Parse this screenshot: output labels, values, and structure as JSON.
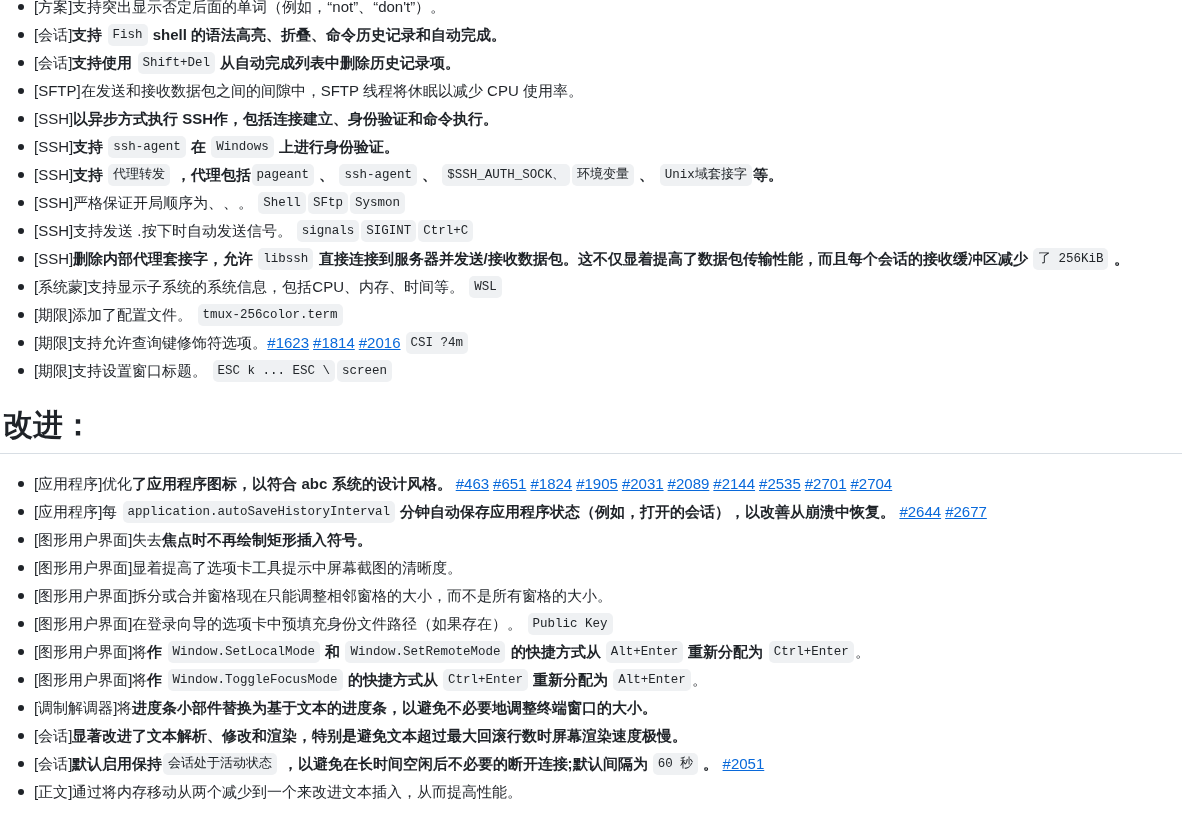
{
  "features": [
    {
      "parts": [
        {
          "kind": "text",
          "text": "[方案]支持突出显示否定后面的单词（例如，“not”、“don't”）。"
        }
      ]
    },
    {
      "parts": [
        {
          "kind": "text",
          "text": "[会话]**支持** "
        },
        {
          "kind": "code",
          "text": "Fish"
        },
        {
          "kind": "text",
          "text": " **shell 的语法高亮、折叠、命令历史记录和自动完成。**"
        }
      ]
    },
    {
      "parts": [
        {
          "kind": "text",
          "text": "[会话]**支持使用** "
        },
        {
          "kind": "code",
          "text": "Shift+Del"
        },
        {
          "kind": "text",
          "text": " **从自动完成列表中删除历史记录项。**"
        }
      ]
    },
    {
      "parts": [
        {
          "kind": "text",
          "text": "[SFTP]在发送和接收数据包之间的间隙中，SFTP 线程将休眠以减少 CPU 使用率。"
        }
      ]
    },
    {
      "parts": [
        {
          "kind": "text",
          "text": "[SSH]**以异步方式执行 SSH作，包括连接建立、身份验证和命令执行。**"
        }
      ]
    },
    {
      "parts": [
        {
          "kind": "text",
          "text": "[SSH]**支持** "
        },
        {
          "kind": "code",
          "text": "ssh-agent"
        },
        {
          "kind": "text",
          "text": " **在** "
        },
        {
          "kind": "code",
          "text": "Windows"
        },
        {
          "kind": "text",
          "text": " **上进行身份验证。**"
        }
      ]
    },
    {
      "parts": [
        {
          "kind": "text",
          "text": "[SSH]**支持** "
        },
        {
          "kind": "code",
          "text": "代理转发"
        },
        {
          "kind": "text",
          "text": " **，代理包括**"
        },
        {
          "kind": "code",
          "text": "pageant"
        },
        {
          "kind": "text",
          "text": " **、** "
        },
        {
          "kind": "code",
          "text": "ssh-agent"
        },
        {
          "kind": "text",
          "text": " **、** "
        },
        {
          "kind": "code",
          "text": "$SSH_AUTH_SOCK、"
        },
        {
          "kind": "code",
          "text": "环境变量"
        },
        {
          "kind": "text",
          "text": " **、** "
        },
        {
          "kind": "code",
          "text": "Unix域套接字"
        },
        {
          "kind": "text",
          "text": "**等。**"
        }
      ]
    },
    {
      "parts": [
        {
          "kind": "text",
          "text": "[SSH]严格保证开局顺序为、、。 "
        },
        {
          "kind": "code",
          "text": "Shell"
        },
        {
          "kind": "code",
          "text": "SFtp"
        },
        {
          "kind": "code",
          "text": "Sysmon"
        }
      ]
    },
    {
      "parts": [
        {
          "kind": "text",
          "text": "[SSH]支持发送 .按下时自动发送信号。 "
        },
        {
          "kind": "code",
          "text": "signals"
        },
        {
          "kind": "code",
          "text": "SIGINT"
        },
        {
          "kind": "code",
          "text": "Ctrl+C"
        }
      ]
    },
    {
      "parts": [
        {
          "kind": "text",
          "text": "[SSH]**删除内部代理套接字，允许** "
        },
        {
          "kind": "code",
          "text": "libssh"
        },
        {
          "kind": "text",
          "text": " **直接连接到服务器并发送/接收数据包。这不仅显着提高了数据包传输性能，而且每个会话的接收缓冲区减少** "
        },
        {
          "kind": "code",
          "text": "了 256KiB"
        },
        {
          "kind": "text",
          "text": " **。**"
        }
      ]
    },
    {
      "parts": [
        {
          "kind": "text",
          "text": "[系统蒙]支持显示子系统的系统信息，包括CPU、内存、时间等。 "
        },
        {
          "kind": "code",
          "text": "WSL"
        }
      ]
    },
    {
      "parts": [
        {
          "kind": "text",
          "text": "[期限]添加了配置文件。 "
        },
        {
          "kind": "code",
          "text": "tmux-256color.term"
        }
      ]
    },
    {
      "parts": [
        {
          "kind": "text",
          "text": "[期限]支持允许查询键修饰符选项。"
        },
        {
          "kind": "link",
          "text": "#1623"
        },
        {
          "kind": "link",
          "text": "#1814"
        },
        {
          "kind": "link",
          "text": "#2016"
        },
        {
          "kind": "code",
          "text": "CSI ?4m"
        }
      ]
    },
    {
      "parts": [
        {
          "kind": "text",
          "text": "[期限]支持设置窗口标题。 "
        },
        {
          "kind": "code",
          "text": "ESC k ... ESC \\"
        },
        {
          "kind": "code",
          "text": "screen"
        }
      ]
    }
  ],
  "improvements_heading": "改进：",
  "improvements": [
    {
      "parts": [
        {
          "kind": "text",
          "text": "[应用程序]优化**了应用程序图标，以符合 abc 系统的设计风格。** "
        },
        {
          "kind": "link",
          "text": "#463"
        },
        {
          "kind": "link",
          "text": "#651"
        },
        {
          "kind": "link",
          "text": "#1824"
        },
        {
          "kind": "link",
          "text": "#1905"
        },
        {
          "kind": "link",
          "text": "#2031"
        },
        {
          "kind": "link",
          "text": "#2089"
        },
        {
          "kind": "link",
          "text": "#2144"
        },
        {
          "kind": "link",
          "text": "#2535"
        },
        {
          "kind": "link",
          "text": "#2701"
        },
        {
          "kind": "link",
          "text": "#2704"
        }
      ]
    },
    {
      "parts": [
        {
          "kind": "text",
          "text": "[应用程序]每 "
        },
        {
          "kind": "code",
          "text": "application.autoSaveHistoryInterval"
        },
        {
          "kind": "text",
          "text": " **分钟自动保存应用程序状态（例如，打开的会话），以改善从崩溃中恢复。** "
        },
        {
          "kind": "link",
          "text": "#2644"
        },
        {
          "kind": "link",
          "text": "#2677"
        }
      ]
    },
    {
      "parts": [
        {
          "kind": "text",
          "text": "[图形用户界面]失去**焦点时不再绘制矩形插入符号。**"
        }
      ]
    },
    {
      "parts": [
        {
          "kind": "text",
          "text": "[图形用户界面]显着提高了选项卡工具提示中屏幕截图的清晰度。"
        }
      ]
    },
    {
      "parts": [
        {
          "kind": "text",
          "text": "[图形用户界面]拆分或合并窗格现在只能调整相邻窗格的大小，而不是所有窗格的大小。"
        }
      ]
    },
    {
      "parts": [
        {
          "kind": "text",
          "text": "[图形用户界面]在登录向导的选项卡中预填充身份文件路径（如果存在）。 "
        },
        {
          "kind": "code",
          "text": "Public Key"
        }
      ]
    },
    {
      "parts": [
        {
          "kind": "text",
          "text": "[图形用户界面]将**作** "
        },
        {
          "kind": "code",
          "text": "Window.SetLocalMode"
        },
        {
          "kind": "text",
          "text": " **和** "
        },
        {
          "kind": "code",
          "text": "Window.SetRemoteMode"
        },
        {
          "kind": "text",
          "text": " **的快捷方式从** "
        },
        {
          "kind": "code",
          "text": "Alt+Enter"
        },
        {
          "kind": "text",
          "text": " **重新分配为** "
        },
        {
          "kind": "code",
          "text": "Ctrl+Enter"
        },
        {
          "kind": "text",
          "text": "。"
        }
      ]
    },
    {
      "parts": [
        {
          "kind": "text",
          "text": "[图形用户界面]将**作** "
        },
        {
          "kind": "code",
          "text": "Window.ToggleFocusMode"
        },
        {
          "kind": "text",
          "text": " **的快捷方式从** "
        },
        {
          "kind": "code",
          "text": "Ctrl+Enter"
        },
        {
          "kind": "text",
          "text": " **重新分配为** "
        },
        {
          "kind": "code",
          "text": "Alt+Enter"
        },
        {
          "kind": "text",
          "text": "。"
        }
      ]
    },
    {
      "parts": [
        {
          "kind": "text",
          "text": "[调制解调器]将**进度条小部件替换为基于文本的进度条，以避免不必要地调整终端窗口的大小。**"
        }
      ]
    },
    {
      "parts": [
        {
          "kind": "text",
          "text": "[会话]**显著改进了文本解析、修改和渲染，特别是避免文本超过最大回滚行数时屏幕渲染速度极慢。**"
        }
      ]
    },
    {
      "parts": [
        {
          "kind": "text",
          "text": "[会话]**默认启用保持**"
        },
        {
          "kind": "code",
          "text": "会话处于活动状态"
        },
        {
          "kind": "text",
          "text": " **，以避免在长时间空闲后不必要的断开连接;默认间隔为** "
        },
        {
          "kind": "code",
          "text": "60 秒"
        },
        {
          "kind": "text",
          "text": " **。** "
        },
        {
          "kind": "link",
          "text": "#2051"
        }
      ]
    },
    {
      "parts": [
        {
          "kind": "text",
          "text": "[正文]通过将内存移动从两个减少到一个来改进文本插入，从而提高性能。"
        }
      ]
    }
  ]
}
